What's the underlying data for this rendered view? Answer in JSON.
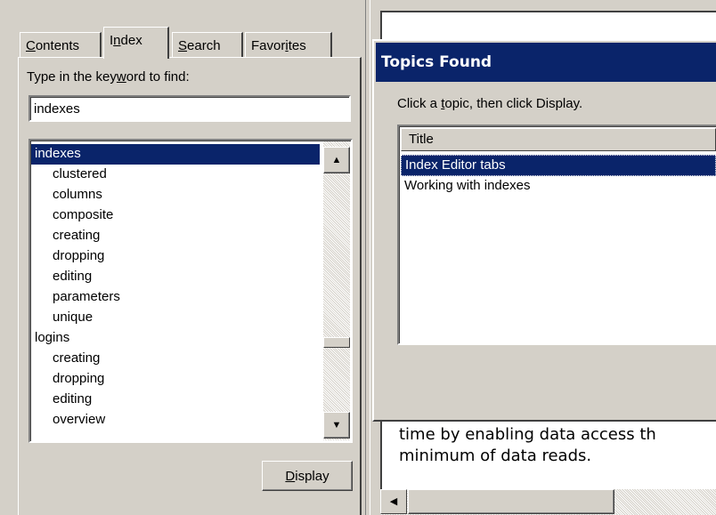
{
  "tabs": [
    {
      "label_pre": "",
      "label_key": "C",
      "label_post": "ontents"
    },
    {
      "label_pre": "I",
      "label_key": "n",
      "label_post": "dex"
    },
    {
      "label_pre": "",
      "label_key": "S",
      "label_post": "earch"
    },
    {
      "label_pre": "Favor",
      "label_key": "i",
      "label_post": "tes"
    }
  ],
  "index_pane": {
    "keyword_label_pre": "Type in the key",
    "keyword_label_key": "w",
    "keyword_label_post": "ord to find:",
    "keyword_value": "indexes",
    "items": [
      {
        "text": "indexes",
        "level": 0,
        "selected": true
      },
      {
        "text": "clustered",
        "level": 1
      },
      {
        "text": "columns",
        "level": 1
      },
      {
        "text": "composite",
        "level": 1
      },
      {
        "text": "creating",
        "level": 1
      },
      {
        "text": "dropping",
        "level": 1
      },
      {
        "text": "editing",
        "level": 1
      },
      {
        "text": "parameters",
        "level": 1
      },
      {
        "text": "unique",
        "level": 1
      },
      {
        "text": "logins",
        "level": 0
      },
      {
        "text": "creating",
        "level": 1
      },
      {
        "text": "dropping",
        "level": 1
      },
      {
        "text": "editing",
        "level": 1
      },
      {
        "text": "overview",
        "level": 1
      }
    ],
    "display_key": "D",
    "display_rest": "isplay"
  },
  "dialog": {
    "title": "Topics Found",
    "hint_pre": "Click a ",
    "hint_key": "t",
    "hint_post": "opic, then click Display.",
    "column_header": "Title",
    "topics": [
      {
        "text": "Index Editor tabs",
        "selected": true
      },
      {
        "text": "Working with indexes"
      }
    ]
  },
  "content": {
    "line1": "time by enabling data access th",
    "line2": "minimum of data reads."
  },
  "colors": {
    "window_face": "#d4d0c8",
    "selection": "#0a246a",
    "selection_text": "#ffffff"
  },
  "icons": {
    "scroll_up": "▲",
    "scroll_down": "▼",
    "scroll_left": "◀"
  }
}
